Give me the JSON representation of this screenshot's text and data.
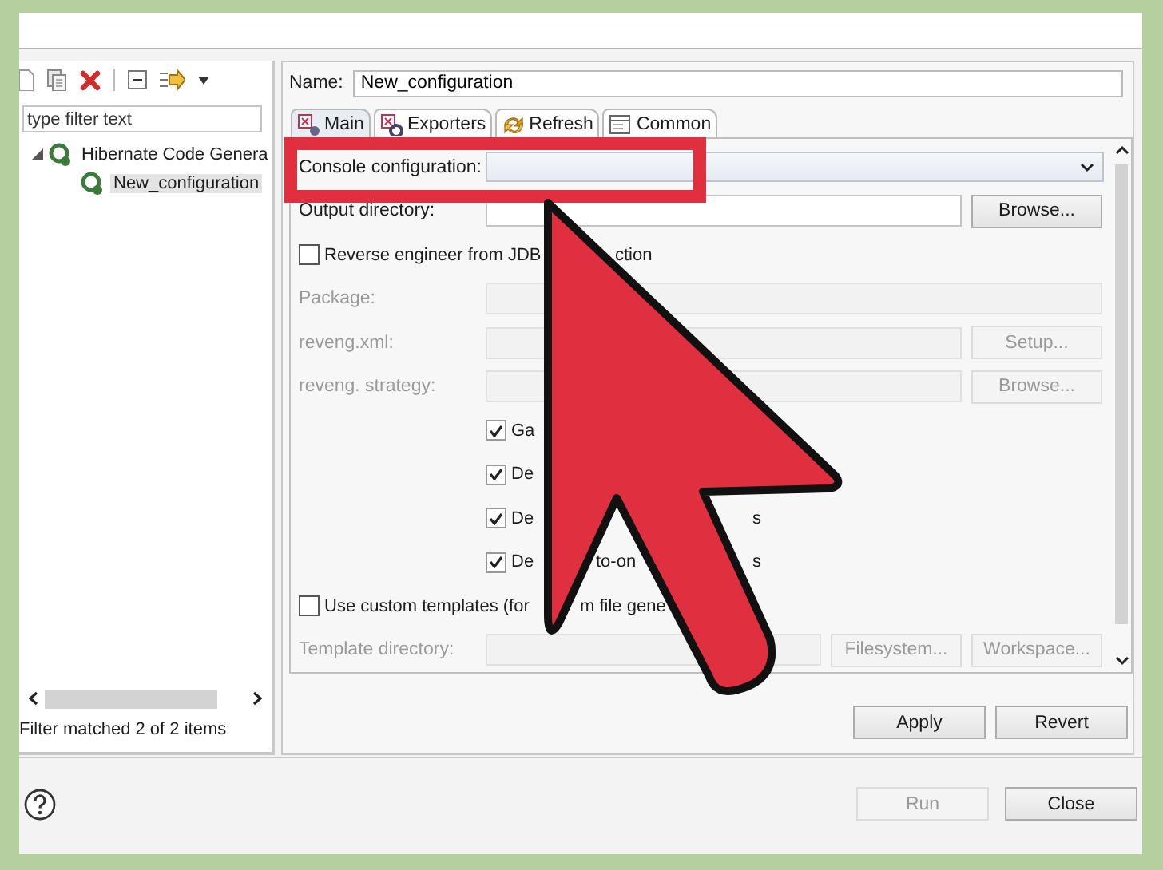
{
  "left_panel": {
    "filter": {
      "placeholder": "type filter text"
    },
    "tree": [
      {
        "label": "Hibernate Code Genera",
        "expanded": true,
        "selected": false,
        "children": [
          {
            "label": "New_configuration",
            "selected": true
          }
        ]
      }
    ],
    "status": "Filter matched 2 of 2 items"
  },
  "name": {
    "label": "Name:",
    "value": "New_configuration"
  },
  "tabs": [
    {
      "label": "Main",
      "selected": true
    },
    {
      "label": "Exporters",
      "selected": false
    },
    {
      "label": "Refresh",
      "selected": false
    },
    {
      "label": "Common",
      "selected": false
    }
  ],
  "form": [
    {
      "kind": "combo",
      "label": "Console configuration:"
    },
    {
      "kind": "text",
      "label": "Output directory:",
      "disabled": false,
      "buttons": [
        {
          "label": "Browse...",
          "disabled": false
        }
      ]
    },
    {
      "kind": "check",
      "checked": false,
      "label": "Reverse engineer from JDB",
      "mid": "ction"
    },
    {
      "kind": "text",
      "label": "Package:",
      "disabled": true
    },
    {
      "kind": "text",
      "label": "reveng.xml:",
      "disabled": true,
      "buttons": [
        {
          "label": "Setup...",
          "disabled": true
        }
      ]
    },
    {
      "kind": "text",
      "label": "reveng. strategy:",
      "disabled": true,
      "buttons": [
        {
          "label": "Browse...",
          "disabled": true
        }
      ]
    },
    {
      "kind": "subcheck",
      "checked": true,
      "label": "Ga"
    },
    {
      "kind": "subcheck",
      "checked": true,
      "label": "De"
    },
    {
      "kind": "subcheck",
      "checked": true,
      "label": "De",
      "end": "s"
    },
    {
      "kind": "subcheck",
      "checked": true,
      "label": "De",
      "mid": "to-on",
      "end": "s"
    },
    {
      "kind": "check",
      "checked": false,
      "label": "Use custom templates (for",
      "mid": "m file gene"
    },
    {
      "kind": "text",
      "label": "Template directory:",
      "disabled": true,
      "buttons": [
        {
          "label": "Filesystem...",
          "disabled": true
        },
        {
          "label": "Workspace...",
          "disabled": true
        }
      ]
    }
  ],
  "actions": [
    {
      "label": "Apply",
      "disabled": false
    },
    {
      "label": "Revert",
      "disabled": false
    }
  ],
  "footer_buttons": [
    {
      "label": "Run",
      "disabled": true
    },
    {
      "label": "Close",
      "disabled": false
    }
  ]
}
